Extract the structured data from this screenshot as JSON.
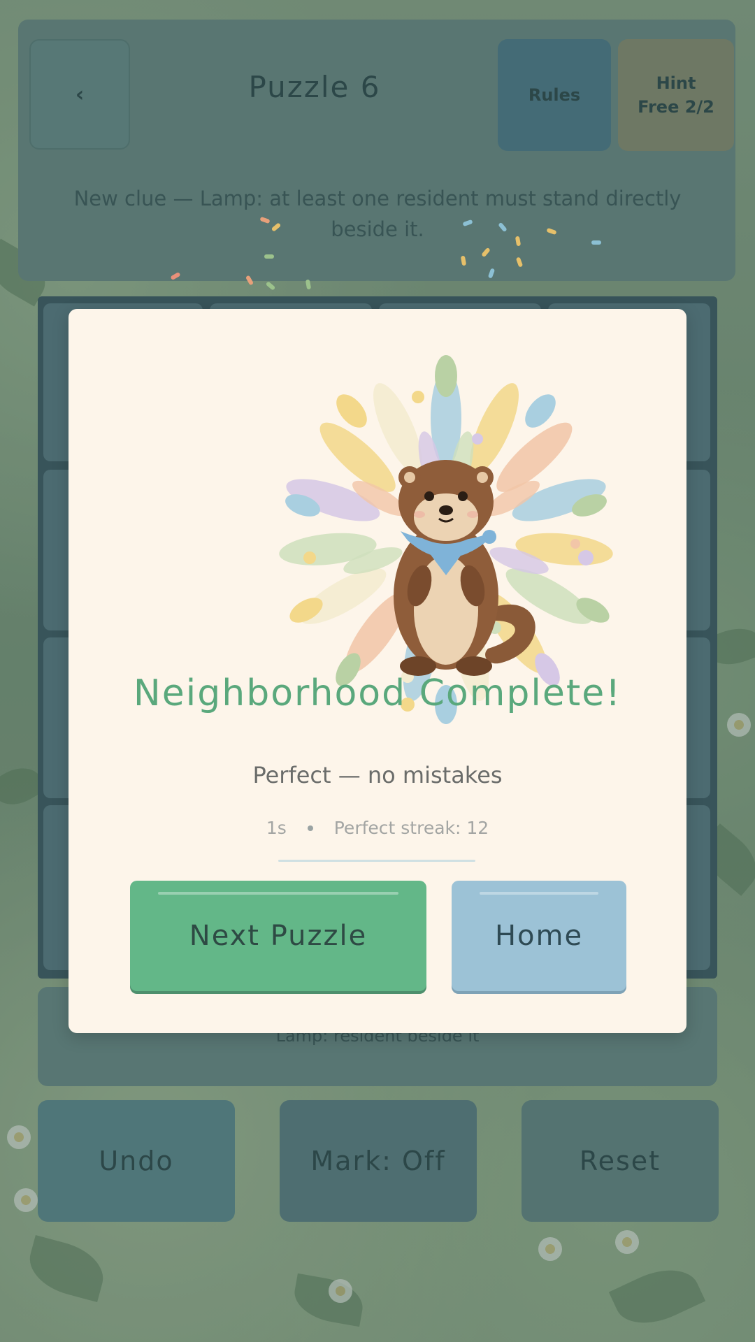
{
  "header": {
    "back_label": "‹",
    "title": "Puzzle 6",
    "rules_label": "Rules",
    "hint_line1": "Hint",
    "hint_line2": "Free 2/2",
    "clue": "New clue — Lamp: at least one resident must stand directly beside it."
  },
  "status": {
    "text": "Lamp: resident beside it"
  },
  "controls": {
    "undo_label": "Undo",
    "mark_label": "Mark: Off",
    "reset_label": "Reset"
  },
  "modal": {
    "title": "Neighborhood Complete!",
    "subtitle": "Perfect — no mistakes",
    "time": "1s",
    "streak": "Perfect streak: 12",
    "next_label": "Next Puzzle",
    "home_label": "Home",
    "illustration_icon": "otter-with-bandana-icon"
  },
  "colors": {
    "title_green": "#5aa87c",
    "next_button": "#63b788",
    "home_button": "#9cc2d6",
    "modal_bg": "#fdf5ea"
  }
}
